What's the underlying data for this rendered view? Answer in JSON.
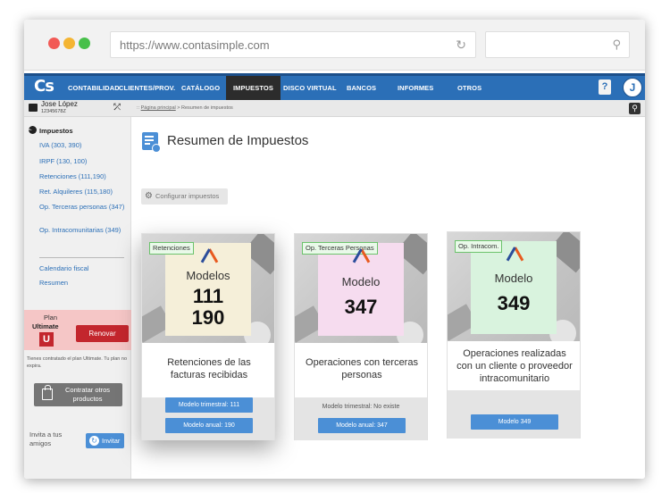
{
  "browser": {
    "url": "https://www.contasimple.com",
    "reload_glyph": "↻",
    "search_glyph": "⚲"
  },
  "nav": {
    "logo": "Cs",
    "items": [
      {
        "label": "CONTABILIDAD"
      },
      {
        "label": "CLIENTES/PROV."
      },
      {
        "label": "CATÁLOGO"
      },
      {
        "label": "IMPUESTOS",
        "active": true
      },
      {
        "label": "DISCO VIRTUAL"
      },
      {
        "label": "BANCOS"
      },
      {
        "label": "INFORMES"
      },
      {
        "label": "OTROS"
      }
    ],
    "help_label": "?",
    "user_initial": "J"
  },
  "user": {
    "name": "Jose López",
    "id": "12345678Z",
    "swap_glyph": "⤱"
  },
  "breadcrumb": {
    "home": "Página principal",
    "separator": " > ",
    "current": "Resumen de impuestos",
    "prefix": "::"
  },
  "sidebar": {
    "section_title": "Impuestos",
    "links": [
      {
        "label": "IVA (303, 390)"
      },
      {
        "label": "IRPF (130, 100)"
      },
      {
        "label": "Retenciones (111,190)"
      },
      {
        "label": "Ret. Alquileres (115,180)"
      },
      {
        "label": "Op. Terceras personas (347)"
      },
      {
        "label": "Op. Intracomunitarias (349)"
      }
    ],
    "links_after": [
      {
        "label": "Calendario fiscal"
      },
      {
        "label": "Resumen"
      }
    ],
    "plan": {
      "label": "Plan",
      "name": "Ultimate",
      "badge": "U",
      "renew_label": "Renovar",
      "note": "Tienes contratado el plan Ultimate. Tu plan no expira."
    },
    "contract_label": "Contratar otros productos",
    "invite_text": "Invita a tus amigos",
    "invite_label": "Invitar"
  },
  "main": {
    "title": "Resumen de Impuestos",
    "config_label": "Configurar impuestos",
    "cards": [
      {
        "tag": "Retenciones",
        "modelo_label": "Modelos",
        "modelo_lines": [
          "111",
          "190"
        ],
        "sheet_color": "#f5efd9",
        "description": "Retenciones de las facturas recibidas",
        "buttons": [
          "Modelo trimestral: 111",
          "Modelo anual: 190"
        ],
        "note": ""
      },
      {
        "tag": "Op. Terceras Personas",
        "modelo_label": "Modelo",
        "modelo_lines": [
          "347"
        ],
        "sheet_color": "#f6dcef",
        "description": "Operaciones con terceras personas",
        "buttons": [
          "Modelo anual: 347"
        ],
        "note": "Modelo trimestral: No existe"
      },
      {
        "tag": "Op. Intracom.",
        "modelo_label": "Modelo",
        "modelo_lines": [
          "349"
        ],
        "sheet_color": "#d9f3de",
        "description": "Operaciones realizadas con un cliente o proveedor intracomunitario",
        "buttons": [
          "Modelo 349"
        ],
        "note": ""
      }
    ]
  }
}
